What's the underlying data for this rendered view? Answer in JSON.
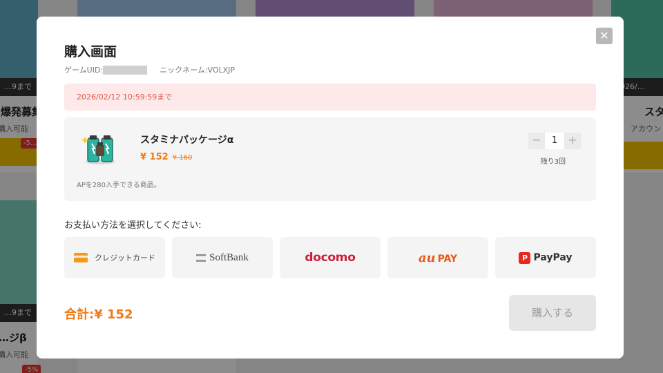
{
  "background": {
    "cards": [
      {
        "date": "…9まで",
        "title": "…爆発募集",
        "sub": "…購入可能",
        "discount": "-5…"
      },
      {
        "date": "2026/…",
        "title": "スタ…",
        "sub": "アカウント…",
        "discount": ""
      },
      {
        "date": "…9まで",
        "title": "…ジβ",
        "sub": "…購入可能",
        "discount": "-5%"
      }
    ]
  },
  "modal": {
    "title": "購入画面",
    "game_uid_label": "ゲームUID:",
    "nickname": "ニックネーム:VOLXJP",
    "deadline": "2026/02/12 10:59:59まで",
    "product": {
      "name": "スタミナパッケージα",
      "price": "¥ 152",
      "original_price": "¥ 160",
      "description": "APを280入手できる商品。",
      "quantity": "1",
      "minus_symbol": "−",
      "plus_symbol": "+",
      "remaining": "残り3回",
      "image_icon": "stamina-battery-icon"
    },
    "payment_label": "お支払い方法を選択してください:",
    "payment_methods": {
      "credit": "クレジットカード",
      "softbank": "SoftBank",
      "docomo": "docomo",
      "au_mark": "au",
      "au_pay": "PAY",
      "paypay_mark": "P",
      "paypay": "PayPay"
    },
    "total": "合計:¥ 152",
    "buy_button": "購入する",
    "close_symbol": "✕"
  },
  "colors": {
    "accent_orange": "#f07a14",
    "deadline_bg": "#fde9e9",
    "deadline_text": "#e15a4a",
    "docomo_red": "#cc1f3a",
    "au_orange": "#e85a1a",
    "paypay_red": "#e8281e"
  }
}
